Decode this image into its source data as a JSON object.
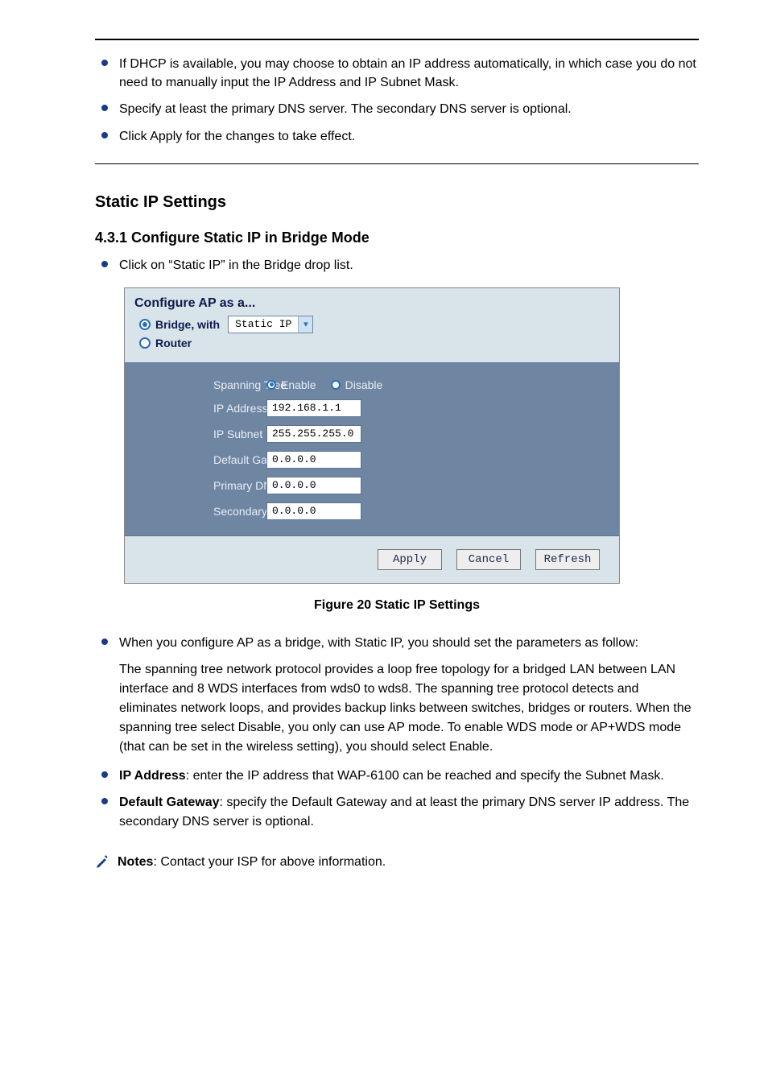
{
  "top_list": {
    "items": [
      "If DHCP is available, you may choose to obtain an IP address automatically, in which case you do not need to manually input the IP Address and IP Subnet Mask.",
      "Specify at least the primary DNS server. The secondary DNS server is optional.",
      "Click Apply for the changes to take effect."
    ]
  },
  "section": {
    "heading": "Static IP Settings",
    "subheading": "4.3.1 Configure Static IP in Bridge Mode",
    "intro_bullet": "Click on “Static IP” in the Bridge drop list."
  },
  "config_panel": {
    "title": "Configure AP as a...",
    "bridge_label": "Bridge, with",
    "select_value": "Static IP",
    "router_label": "Router",
    "rows": {
      "spanning_tree": {
        "label": "Spanning Tree",
        "enable": "Enable",
        "disable": "Disable"
      },
      "ip_address": {
        "label": "IP Address",
        "value": "192.168.1.1"
      },
      "subnet": {
        "label": "IP Subnet Mask",
        "value": "255.255.255.0"
      },
      "gateway": {
        "label": "Default Gateway",
        "value": "0.0.0.0"
      },
      "primary_dns": {
        "label": "Primary DNS Server",
        "value": "0.0.0.0"
      },
      "secondary_dns": {
        "label": "Secondary DNS Server",
        "value": "0.0.0.0"
      }
    },
    "buttons": {
      "apply": "Apply",
      "cancel": "Cancel",
      "refresh": "Refresh"
    }
  },
  "caption": "Figure 20 Static IP Settings",
  "after_figure": {
    "para_intro": "When you configure AP as a bridge, with Static IP, you should set the parameters as follow:",
    "spanning": "The spanning tree network protocol provides a loop free topology for a bridged LAN between LAN interface and 8 WDS interfaces from wds0 to wds8. The spanning tree protocol detects and eliminates network loops, and provides backup links between switches, bridges or routers. When the spanning tree select Disable, you only can use AP mode. To enable WDS mode or AP+WDS mode (that can be set in the wireless setting), you should select Enable."
  },
  "bullets2": {
    "ip_addr": {
      "lead": "IP Address",
      "rest": "enter the IP address that WAP-6100 can be reached and specify the Subnet Mask."
    },
    "gateway": {
      "lead": "Default Gateway",
      "rest": "specify the Default Gateway and at least the primary DNS server IP address. The secondary DNS server is optional."
    }
  },
  "note": {
    "lead": "Notes",
    "rest": "Contact your ISP for above information."
  }
}
